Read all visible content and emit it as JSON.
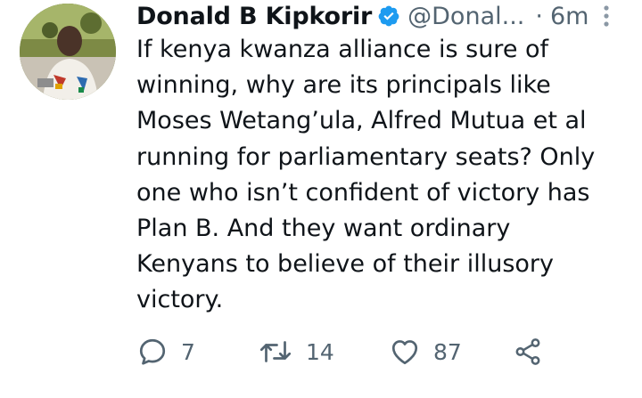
{
  "tweet": {
    "author": {
      "display_name": "Donald B Kipkorir",
      "handle": "@Donal...",
      "verified": true
    },
    "separator": "·",
    "time": "6m",
    "text_lines": [
      "If kenya kwanza alliance is sure of",
      "winning, why are its principals like",
      "Moses Wetang’ula, Alfred Mutua et al",
      "running for parliamentary seats? Only",
      "one who isn’t confident of victory has",
      "Plan B. And they want ordinary",
      "Kenyans to believe of their illusory",
      "victory."
    ],
    "actions": {
      "replies": "7",
      "retweets": "14",
      "likes": "87"
    }
  },
  "icons": {
    "verified": "verified-badge-icon",
    "more": "more-vertical-icon",
    "reply": "reply-icon",
    "retweet": "retweet-icon",
    "like": "heart-icon",
    "share": "share-icon"
  },
  "colors": {
    "text": "#0f1419",
    "secondary": "#536471",
    "verified": "#1d9bf0"
  }
}
